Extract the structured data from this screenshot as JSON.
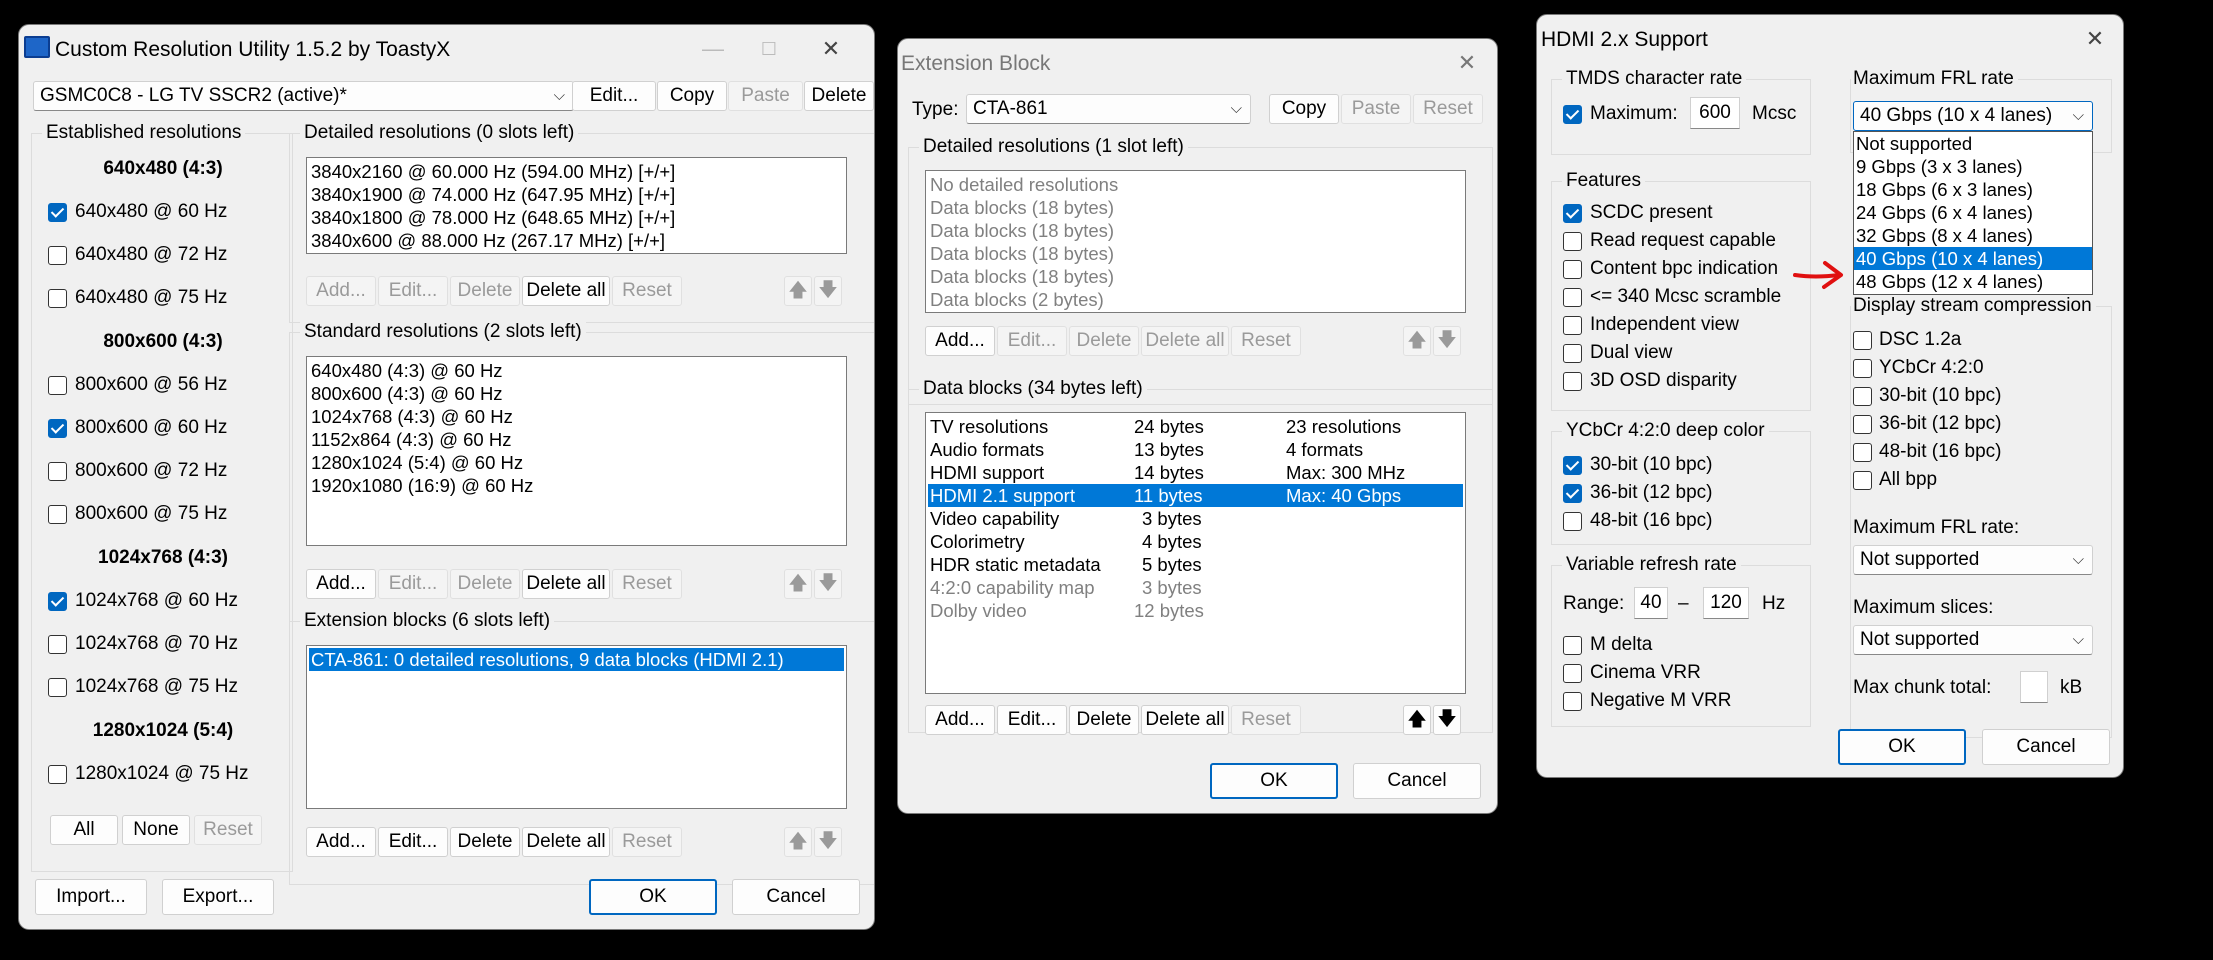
{
  "cru": {
    "title": "Custom Resolution Utility 1.5.2 by ToastyX",
    "monitor": "GSMC0C8 - LG TV SSCR2 (active)*",
    "top_buttons": [
      "Edit...",
      "Copy",
      "Paste",
      "Delete"
    ],
    "established": {
      "title": "Established resolutions",
      "groups": [
        {
          "header": "640x480 (4:3)",
          "items": [
            {
              "label": "640x480 @ 60 Hz",
              "checked": true
            },
            {
              "label": "640x480 @ 72 Hz",
              "checked": false
            },
            {
              "label": "640x480 @ 75 Hz",
              "checked": false
            }
          ]
        },
        {
          "header": "800x600 (4:3)",
          "items": [
            {
              "label": "800x600 @ 56 Hz",
              "checked": false
            },
            {
              "label": "800x600 @ 60 Hz",
              "checked": true
            },
            {
              "label": "800x600 @ 72 Hz",
              "checked": false
            },
            {
              "label": "800x600 @ 75 Hz",
              "checked": false
            }
          ]
        },
        {
          "header": "1024x768 (4:3)",
          "items": [
            {
              "label": "1024x768 @ 60 Hz",
              "checked": true
            },
            {
              "label": "1024x768 @ 70 Hz",
              "checked": false
            },
            {
              "label": "1024x768 @ 75 Hz",
              "checked": false
            }
          ]
        },
        {
          "header": "1280x1024 (5:4)",
          "items": [
            {
              "label": "1280x1024 @ 75 Hz",
              "checked": false
            }
          ]
        }
      ],
      "buttons": [
        "All",
        "None",
        "Reset"
      ]
    },
    "detailed": {
      "title": "Detailed resolutions (0 slots left)",
      "items": [
        "3840x2160 @ 60.000 Hz (594.00 MHz) [+/+]",
        "3840x1900 @ 74.000 Hz (647.95 MHz) [+/+]",
        "3840x1800 @ 78.000 Hz (648.65 MHz) [+/+]",
        "3840x600 @ 88.000 Hz (267.17 MHz) [+/+]"
      ],
      "buttons": [
        "Add...",
        "Edit...",
        "Delete",
        "Delete all",
        "Reset"
      ]
    },
    "standard": {
      "title": "Standard resolutions (2 slots left)",
      "items": [
        "640x480 (4:3) @ 60 Hz",
        "800x600 (4:3) @ 60 Hz",
        "1024x768 (4:3) @ 60 Hz",
        "1152x864 (4:3) @ 60 Hz",
        "1280x1024 (5:4) @ 60 Hz",
        "1920x1080 (16:9) @ 60 Hz"
      ],
      "buttons": [
        "Add...",
        "Edit...",
        "Delete",
        "Delete all",
        "Reset"
      ]
    },
    "extension": {
      "title": "Extension blocks (6 slots left)",
      "items": [
        "CTA-861: 0 detailed resolutions, 9 data blocks (HDMI 2.1)"
      ],
      "buttons": [
        "Add...",
        "Edit...",
        "Delete",
        "Delete all",
        "Reset"
      ]
    },
    "bottom": {
      "import": "Import...",
      "export": "Export...",
      "ok": "OK",
      "cancel": "Cancel"
    }
  },
  "ext": {
    "title": "Extension Block",
    "type_label": "Type:",
    "type_value": "CTA-861",
    "type_buttons": [
      "Copy",
      "Paste",
      "Reset"
    ],
    "detailed": {
      "title": "Detailed resolutions (1 slot left)",
      "items": [
        "No detailed resolutions",
        "Data blocks (18 bytes)",
        "Data blocks (18 bytes)",
        "Data blocks (18 bytes)",
        "Data blocks (18 bytes)",
        "Data blocks (2 bytes)"
      ],
      "buttons": [
        "Add...",
        "Edit...",
        "Delete",
        "Delete all",
        "Reset"
      ]
    },
    "datablocks": {
      "title": "Data blocks (34 bytes left)",
      "rows": [
        {
          "name": "TV resolutions",
          "bytes": "24 bytes",
          "info": "23 resolutions"
        },
        {
          "name": "Audio formats",
          "bytes": "13 bytes",
          "info": "4 formats"
        },
        {
          "name": "HDMI support",
          "bytes": "14 bytes",
          "info": "Max: 300 MHz"
        },
        {
          "name": "HDMI 2.1 support",
          "bytes": "11 bytes",
          "info": "Max: 40 Gbps"
        },
        {
          "name": "Video capability",
          "bytes": "3 bytes",
          "info": ""
        },
        {
          "name": "Colorimetry",
          "bytes": "4 bytes",
          "info": ""
        },
        {
          "name": "HDR static metadata",
          "bytes": "5 bytes",
          "info": ""
        },
        {
          "name": "4:2:0 capability map",
          "bytes": "3 bytes",
          "info": ""
        },
        {
          "name": "Dolby video",
          "bytes": "12 bytes",
          "info": ""
        }
      ],
      "buttons": [
        "Add...",
        "Edit...",
        "Delete",
        "Delete all",
        "Reset"
      ]
    },
    "ok": "OK",
    "cancel": "Cancel"
  },
  "hdmi": {
    "title": "HDMI 2.x Support",
    "tmds": {
      "title": "TMDS character rate",
      "maximum_label": "Maximum:",
      "value": "600",
      "unit": "Mcsc"
    },
    "features": {
      "title": "Features",
      "items": [
        {
          "label": "SCDC present",
          "checked": true
        },
        {
          "label": "Read request capable",
          "checked": false
        },
        {
          "label": "Content bpc indication",
          "checked": false
        },
        {
          "label": "<= 340 Mcsc scramble",
          "checked": false
        },
        {
          "label": "Independent view",
          "checked": false
        },
        {
          "label": "Dual view",
          "checked": false
        },
        {
          "label": "3D OSD disparity",
          "checked": false
        }
      ]
    },
    "ycbcr": {
      "title": "YCbCr 4:2:0 deep color",
      "items": [
        {
          "label": "30-bit (10 bpc)",
          "checked": true
        },
        {
          "label": "36-bit (12 bpc)",
          "checked": true
        },
        {
          "label": "48-bit (16 bpc)",
          "checked": false
        }
      ]
    },
    "vrr": {
      "title": "Variable refresh rate",
      "range_label": "Range:",
      "min": "40",
      "dash": "–",
      "max": "120",
      "unit": "Hz",
      "items": [
        {
          "label": "M delta",
          "checked": false
        },
        {
          "label": "Cinema VRR",
          "checked": false
        },
        {
          "label": "Negative M VRR",
          "checked": false
        }
      ]
    },
    "frl": {
      "title": "Maximum FRL rate",
      "selected": "40 Gbps (10 x 4 lanes)",
      "options": [
        "Not supported",
        "9 Gbps (3 x 3 lanes)",
        "18 Gbps (6 x 3 lanes)",
        "24 Gbps (6 x 4 lanes)",
        "32 Gbps (8 x 4 lanes)",
        "40 Gbps (10 x 4 lanes)",
        "48 Gbps (12 x 4 lanes)"
      ],
      "highlight_index": 5
    },
    "dsc": {
      "title": "Display stream compression",
      "items": [
        {
          "label": "DSC 1.2a",
          "checked": false
        },
        {
          "label": "YCbCr 4:2:0",
          "checked": false
        },
        {
          "label": "30-bit (10 bpc)",
          "checked": false
        },
        {
          "label": "36-bit (12 bpc)",
          "checked": false
        },
        {
          "label": "48-bit (16 bpc)",
          "checked": false
        },
        {
          "label": "All bpp",
          "checked": false
        }
      ],
      "frl_label": "Maximum FRL rate:",
      "frl_value": "Not supported",
      "slices_label": "Maximum slices:",
      "slices_value": "Not supported",
      "chunk_label": "Max chunk total:",
      "chunk_value": "",
      "chunk_unit": "kB"
    },
    "ok": "OK",
    "cancel": "Cancel"
  },
  "colors": {
    "accent": "#0067c0",
    "selection": "#0078d7",
    "annotation_arrow": "#e01010"
  }
}
